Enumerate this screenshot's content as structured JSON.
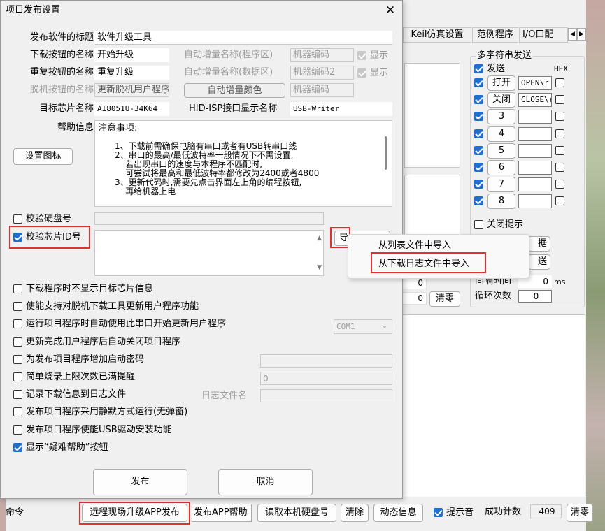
{
  "dialog": {
    "title": "项目发布设置",
    "close_glyph": "✕",
    "fields": {
      "software_title_label": "发布软件的标题",
      "software_title_value": "软件升级工具",
      "download_btn_label": "下载按钮的名称",
      "download_btn_value": "开始升级",
      "repeat_btn_label": "重复按钮的名称",
      "repeat_btn_value": "重复升级",
      "offline_btn_label": "脱机按钮的名称",
      "offline_btn_value": "更新脱机用户程序",
      "target_chip_label": "目标芯片名称",
      "target_chip_value": "AI8051U-34K64",
      "hid_label": "HID-ISP接口显示名称",
      "hid_value": "USB-Writer",
      "help_label": "帮助信息"
    },
    "auto_inc": {
      "prog_label": "自动增量名称(程序区)",
      "prog_value": "机器编码",
      "prog_show": "显示",
      "data_label": "自动增量名称(数据区)",
      "data_value": "机器编码2",
      "data_show": "显示",
      "color_button": "自动增量颜色",
      "color_value": "机器编码"
    },
    "help_text": {
      "heading": "注意事项:",
      "lines": [
        "1、下载前需确保电脑有串口或者有USB转串口线",
        "2、串口的最高/最低波特率一般情况下不需设置,",
        "    若出现串口的速度与本程序不匹配时,",
        "    可尝试将最高和最低波特率都修改为2400或者4800",
        "3、更新代码时,需要先点击界面左上角的编程按钮,",
        "    再给机器上电"
      ]
    },
    "set_icon_button": "设置图标",
    "verify_disk_label": "校验硬盘号",
    "verify_chip_label": "校验芯片ID号",
    "import_button": "导",
    "import_menu": [
      "从列表文件中导入",
      "从下载日志文件中导入"
    ],
    "options": [
      {
        "label": "下载程序时不显示目标芯片信息",
        "checked": false
      },
      {
        "label": "使能支持对脱机下载工具更新用户程序功能",
        "checked": false
      },
      {
        "label": "运行项目程序时自动使用此串口开始更新用户程序",
        "checked": false
      },
      {
        "label": "更新完成用户程序后自动关闭项目程序",
        "checked": false
      },
      {
        "label": "为发布项目程序增加启动密码",
        "checked": false
      },
      {
        "label": "简单烧录上限次数已满提醒",
        "checked": false
      },
      {
        "label": "记录下载信息到日志文件",
        "checked": false
      },
      {
        "label": "发布项目程序采用静默方式运行(无弹窗)",
        "checked": false
      },
      {
        "label": "发布项目程序使能USB驱动安装功能",
        "checked": false
      },
      {
        "label": "显示“疑难帮助”按钮",
        "checked": true
      }
    ],
    "com_value": "COM1",
    "limit_value": "0",
    "log_name_label": "日志文件名",
    "publish_button": "发布",
    "cancel_button": "取消"
  },
  "background": {
    "tabs": [
      "Keil仿真设置",
      "范例程序",
      "I/O口配"
    ],
    "multi_send": {
      "title": "多字符串发送",
      "send_label": "发送",
      "hex_label": "HEX",
      "rows": [
        {
          "label": "打开",
          "value": "OPEN\\r",
          "checked": true
        },
        {
          "label": "关闭",
          "value": "CLOSE\\r",
          "checked": true
        },
        {
          "label": "3",
          "value": "",
          "checked": true
        },
        {
          "label": "4",
          "value": "",
          "checked": true
        },
        {
          "label": "5",
          "value": "",
          "checked": true
        },
        {
          "label": "6",
          "value": "",
          "checked": true
        },
        {
          "label": "7",
          "value": "",
          "checked": true
        },
        {
          "label": "8",
          "value": "",
          "checked": true
        }
      ],
      "close_tip": "关闭提示",
      "btn_a": "据",
      "btn_b": "送",
      "interval_label": "间隔时间",
      "interval_value": "0",
      "interval_unit": "ms",
      "loop_label": "循环次数",
      "loop_value": "0"
    },
    "zero1": "0",
    "zero2": "0",
    "clear_btn": "清零",
    "left_bottom_text": "命令",
    "bottom_bar": {
      "remote_btn": "远程现场升级APP发布",
      "publish_help": "发布APP帮助",
      "read_disk": "读取本机硬盘号",
      "clear": "清除",
      "dynamic": "动态信息",
      "beep_label": "提示音",
      "success_label": "成功计数",
      "success_value": "409",
      "clear2": "清零"
    }
  }
}
